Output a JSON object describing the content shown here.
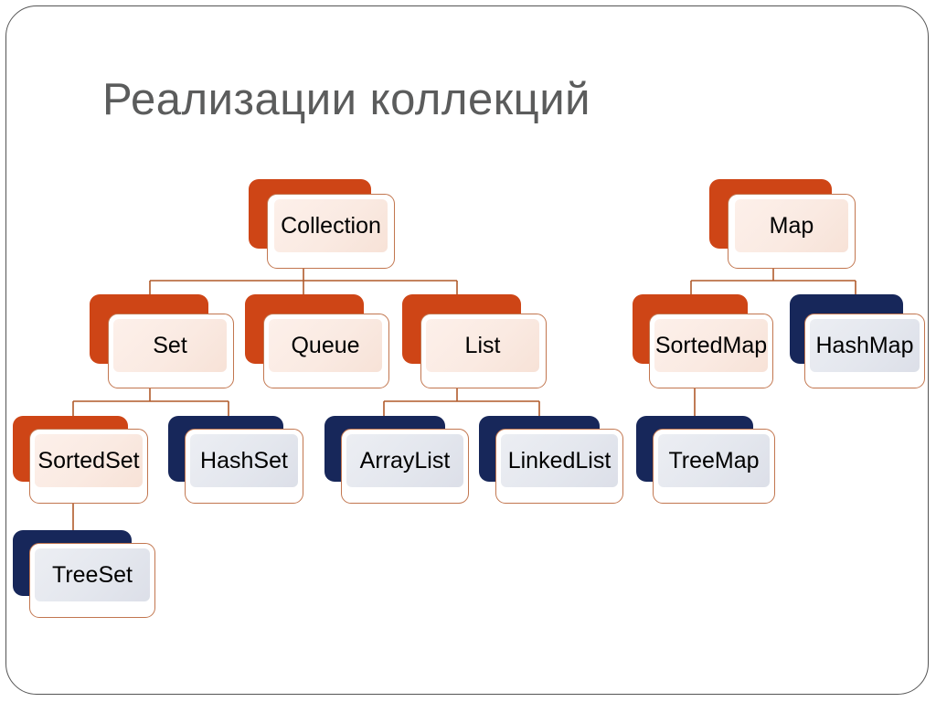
{
  "slide": {
    "title": "Реализации коллекций",
    "title_color": "#5b5c5c",
    "background": "#ffffff",
    "frame_color": "#555555"
  },
  "palette": {
    "orange_shadow": "#ce4516",
    "orange_fill": "#faeae2",
    "navy_shadow": "#17275a",
    "navy_fill": "#e4e7ee",
    "card_border": "#c2764f",
    "connector": "#b05a2a"
  },
  "diagram": {
    "type": "hierarchy-tree",
    "nodes": [
      {
        "id": "collection",
        "label": "Collection",
        "style": "orange",
        "level": 0
      },
      {
        "id": "map",
        "label": "Map",
        "style": "orange",
        "level": 0
      },
      {
        "id": "set",
        "label": "Set",
        "style": "orange",
        "level": 1
      },
      {
        "id": "queue",
        "label": "Queue",
        "style": "orange",
        "level": 1
      },
      {
        "id": "list",
        "label": "List",
        "style": "orange",
        "level": 1
      },
      {
        "id": "sortedmap",
        "label": "SortedMap",
        "style": "orange",
        "level": 1
      },
      {
        "id": "hashmap",
        "label": "HashMap",
        "style": "navy",
        "level": 1
      },
      {
        "id": "sortedset",
        "label": "SortedSet",
        "style": "orange",
        "level": 2
      },
      {
        "id": "hashset",
        "label": "HashSet",
        "style": "navy",
        "level": 2
      },
      {
        "id": "arraylist",
        "label": "ArrayList",
        "style": "navy",
        "level": 2
      },
      {
        "id": "linkedlist",
        "label": "LinkedList",
        "style": "navy",
        "level": 2
      },
      {
        "id": "treemap",
        "label": "TreeMap",
        "style": "navy",
        "level": 2
      },
      {
        "id": "treeset",
        "label": "TreeSet",
        "style": "navy",
        "level": 3
      }
    ],
    "edges": [
      {
        "from": "collection",
        "to": "set"
      },
      {
        "from": "collection",
        "to": "queue"
      },
      {
        "from": "collection",
        "to": "list"
      },
      {
        "from": "map",
        "to": "sortedmap"
      },
      {
        "from": "map",
        "to": "hashmap"
      },
      {
        "from": "set",
        "to": "sortedset"
      },
      {
        "from": "set",
        "to": "hashset"
      },
      {
        "from": "list",
        "to": "arraylist"
      },
      {
        "from": "list",
        "to": "linkedlist"
      },
      {
        "from": "sortedmap",
        "to": "treemap"
      },
      {
        "from": "sortedset",
        "to": "treeset"
      }
    ]
  }
}
